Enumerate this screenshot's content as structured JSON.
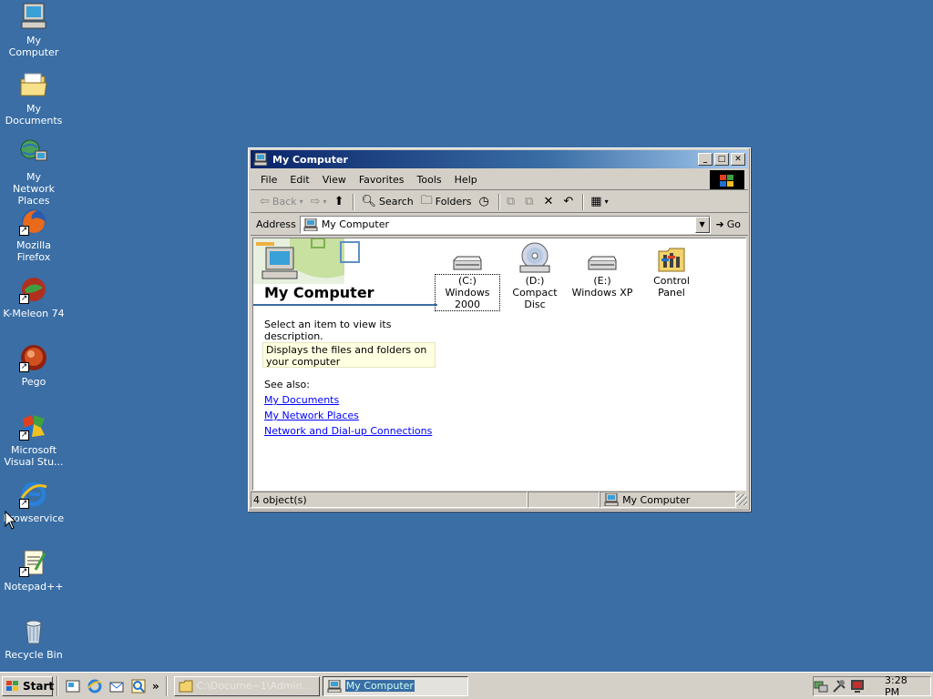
{
  "desktop": {
    "icons": [
      {
        "label": "My Computer",
        "icon": "my-computer-icon"
      },
      {
        "label": "My Documents",
        "icon": "folder-icon"
      },
      {
        "label": "My Network Places",
        "icon": "network-places-icon"
      },
      {
        "label": "Mozilla Firefox",
        "icon": "firefox-icon"
      },
      {
        "label": "K-Meleon 74",
        "icon": "k-meleon-icon"
      },
      {
        "label": "Pego",
        "icon": "pego-icon"
      },
      {
        "label": "Microsoft Visual Stu...",
        "icon": "visual-studio-icon"
      },
      {
        "label": "browservice",
        "icon": "ie-icon"
      },
      {
        "label": "Notepad++",
        "icon": "notepad-icon"
      },
      {
        "label": "Recycle Bin",
        "icon": "recycle-bin-icon"
      }
    ]
  },
  "window": {
    "title": "My Computer",
    "menu": [
      "File",
      "Edit",
      "View",
      "Favorites",
      "Tools",
      "Help"
    ],
    "toolbar": {
      "back": "Back",
      "forward": "",
      "search": "Search",
      "folders": "Folders"
    },
    "address": {
      "label": "Address",
      "value": "My Computer",
      "go": "Go"
    },
    "left_pane": {
      "title": "My Computer",
      "hint": "Select an item to view its description.",
      "description": "Displays the files and folders on your computer",
      "see_also": "See also:",
      "links": [
        "My Documents",
        "My Network Places",
        "Network and Dial-up Connections"
      ]
    },
    "items": [
      {
        "label": "(C:) Windows 2000",
        "icon": "hard-drive-icon",
        "focused": true
      },
      {
        "label": "(D:) Compact Disc",
        "icon": "cd-drive-icon",
        "focused": false
      },
      {
        "label": "(E:) Windows XP",
        "icon": "hard-drive-icon",
        "focused": false
      },
      {
        "label": "Control Panel",
        "icon": "control-panel-icon",
        "focused": false
      }
    ],
    "status": {
      "objects": "4 object(s)",
      "location": "My Computer"
    }
  },
  "taskbar": {
    "start": "Start",
    "tasks": [
      {
        "label": "C:\\Docume~1\\Admin...",
        "active": false
      },
      {
        "label": "My Computer",
        "active": true
      }
    ],
    "clock": "3:28 PM"
  },
  "colors": {
    "desktop": "#3a6ea5",
    "titlebar_start": "#0a246a",
    "face": "#d4d0c8",
    "link": "#0000ff"
  }
}
